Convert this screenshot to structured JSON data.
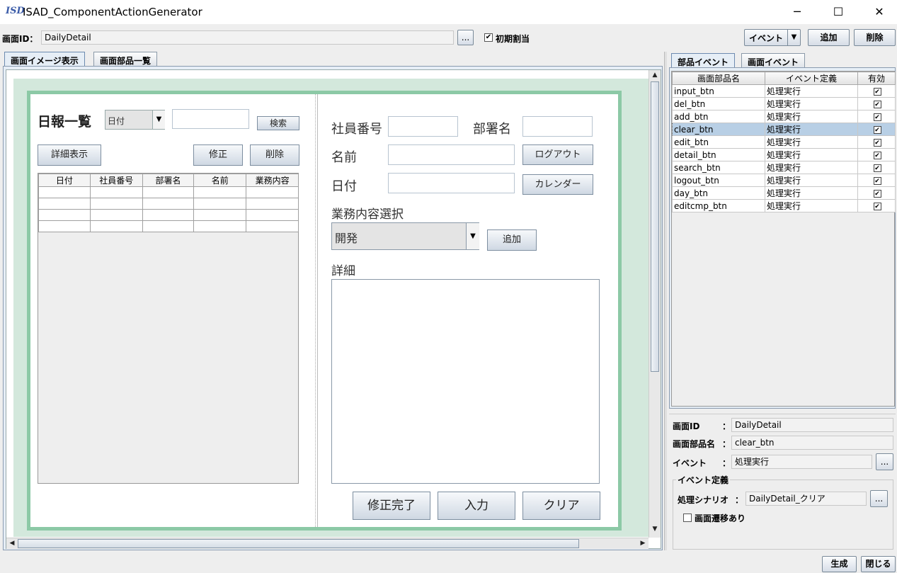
{
  "window": {
    "icon_text": "ISD",
    "title": "ISAD_ComponentActionGenerator",
    "minimize": "─",
    "maximize": "☐",
    "close": "✕"
  },
  "toolbar": {
    "screen_id_label": "画面ID：",
    "screen_id_value": "DailyDetail",
    "browse_label": "...",
    "initial_checked": true,
    "initial_label": "初期割当",
    "event_select": "イベント",
    "add_label": "追加",
    "delete_label": "削除"
  },
  "left_tabs": [
    "画面イメージ表示",
    "画面部品一覧"
  ],
  "canvas": {
    "left_panel": {
      "title": "日報一覧",
      "search_select": "日付",
      "search_value": "",
      "search_button": "検索",
      "detail_button": "詳細表示",
      "edit_button": "修正",
      "delete_button": "削除",
      "table_headers": [
        "日付",
        "社員番号",
        "部署名",
        "名前",
        "業務内容"
      ]
    },
    "right_panel": {
      "employee_no_label": "社員番号",
      "dept_label": "部署名",
      "name_label": "名前",
      "logout_button": "ログアウト",
      "date_label": "日付",
      "calendar_button": "カレンダー",
      "task_select_label": "業務内容選択",
      "task_select_value": "開発",
      "add_button": "追加",
      "detail_label": "詳細",
      "finish_edit_button": "修正完了",
      "input_button": "入力",
      "clear_button": "クリア"
    }
  },
  "right_tabs": [
    "部品イベント",
    "画面イベント"
  ],
  "event_table": {
    "headers": [
      "画面部品名",
      "イベント定義",
      "有効"
    ],
    "rows": [
      {
        "name": "input_btn",
        "event": "処理実行",
        "enabled": true
      },
      {
        "name": "del_btn",
        "event": "処理実行",
        "enabled": true
      },
      {
        "name": "add_btn",
        "event": "処理実行",
        "enabled": true
      },
      {
        "name": "clear_btn",
        "event": "処理実行",
        "enabled": true,
        "selected": true
      },
      {
        "name": "edit_btn",
        "event": "処理実行",
        "enabled": true
      },
      {
        "name": "detail_btn",
        "event": "処理実行",
        "enabled": true
      },
      {
        "name": "search_btn",
        "event": "処理実行",
        "enabled": true
      },
      {
        "name": "logout_btn",
        "event": "処理実行",
        "enabled": true
      },
      {
        "name": "day_btn",
        "event": "処理実行",
        "enabled": true
      },
      {
        "name": "editcmp_btn",
        "event": "処理実行",
        "enabled": true
      }
    ]
  },
  "details": {
    "screen_id_label": "画面ID",
    "screen_id_value": "DailyDetail",
    "part_name_label": "画面部品名",
    "part_name_value": "clear_btn",
    "event_label": "イベント",
    "event_value": "処理実行",
    "colon": "：",
    "browse_label": "...",
    "event_def_group": "イベント定義",
    "scenario_label": "処理シナリオ",
    "scenario_value": "DailyDetail_クリア",
    "transition_label": "画面遷移あり",
    "transition_checked": false
  },
  "footer": {
    "generate_button": "生成",
    "close_button": "閉じる"
  },
  "colors": {
    "canvas_border": "#8cc9a6",
    "canvas_bg": "#d3e8dc",
    "selected_row": "#b8cfe5"
  }
}
